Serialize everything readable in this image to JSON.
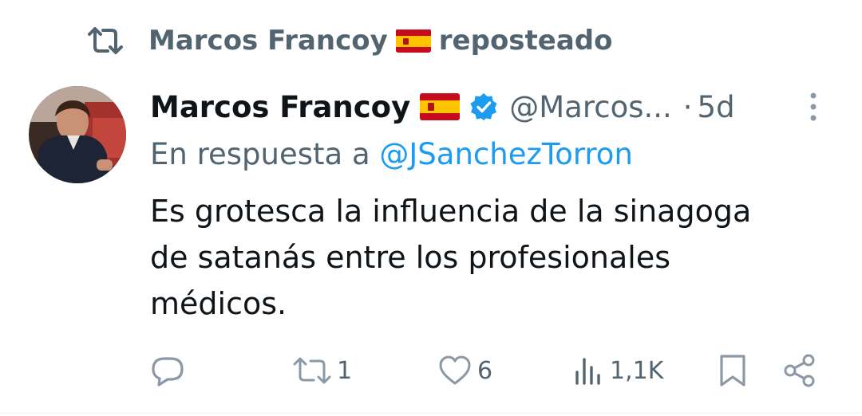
{
  "repost_banner": {
    "icon": "repost-icon",
    "user_name": "Marcos Francoy",
    "flag": "spain-flag",
    "label": "reposteado"
  },
  "tweet": {
    "display_name": "Marcos Francoy",
    "flag": "spain-flag",
    "verified": true,
    "handle": "@Marcos...",
    "separator": "·",
    "time": "5d",
    "reply_prefix": "En respuesta a",
    "reply_mention": "@JSanchezTorron",
    "text_lines": [
      "Es grotesca la influencia de la sinagoga",
      "de satanás entre los profesionales",
      "médicos."
    ],
    "actions": {
      "reply_count": "",
      "repost_count": "1",
      "like_count": "6",
      "views_count": "1,1K"
    }
  },
  "colors": {
    "secondary_text": "#536471",
    "primary_text": "#0f1419",
    "accent": "#1d9bf0"
  }
}
